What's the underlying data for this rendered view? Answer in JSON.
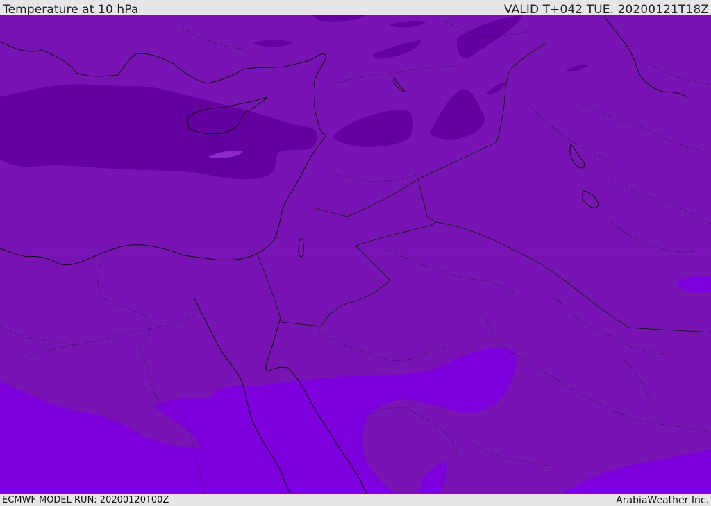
{
  "header": {
    "title": "Temperature at 10 hPa",
    "valid": "VALID T+042 TUE. 20200121T18Z"
  },
  "footer": {
    "model_run": "ECMWF MODEL RUN: 20200120T00Z",
    "credit": "ArabiaWeather Inc."
  },
  "map": {
    "field": "temperature",
    "level": "10 hPa",
    "colors": {
      "cold_dark": "#6400a0",
      "mid": "#7814b4",
      "warm": "#7d00dc",
      "coast": "#111111",
      "border": "#1a1a1a"
    }
  }
}
